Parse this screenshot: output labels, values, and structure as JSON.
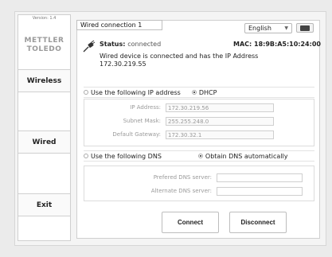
{
  "sidebar": {
    "version": "Version: 1.4",
    "logo_line1": "METTLER",
    "logo_line2": "TOLEDO",
    "wireless_label": "Wireless",
    "wired_label": "Wired",
    "exit_label": "Exit"
  },
  "tab": {
    "label": "Wired connection 1"
  },
  "language": {
    "selected": "English"
  },
  "status": {
    "label": "Status:",
    "value": "connected",
    "mac": "MAC: 18:9B:A5:10:24:00",
    "message_line1": "Wired device is connected and has the IP Address",
    "message_line2": "172.30.219.55"
  },
  "ip": {
    "option_static": "Use the following IP address",
    "option_dhcp": "DHCP",
    "selected": "DHCP",
    "address_label": "IP Address:",
    "address_value": "172.30.219.56",
    "mask_label": "Subnet Mask:",
    "mask_value": "255.255.248.0",
    "gateway_label": "Default Gateway:",
    "gateway_value": "172.30.32.1"
  },
  "dns": {
    "option_static": "Use the following DNS",
    "option_auto": "Obtain DNS automatically",
    "selected": "Obtain DNS automatically",
    "preferred_label": "Prefered DNS server:",
    "preferred_value": "",
    "alternate_label": "Alternate DNS server:",
    "alternate_value": ""
  },
  "actions": {
    "connect_label": "Connect",
    "disconnect_label": "Disconnect"
  },
  "colors": {
    "sidebar_bg": "#ffffff",
    "panel_border": "#cfcfcf",
    "muted_text": "#9a9a9a"
  },
  "icons": {
    "status": "wired-connection-icon",
    "keyboard": "keyboard-icon",
    "dropdown": "chevron-down-icon"
  }
}
